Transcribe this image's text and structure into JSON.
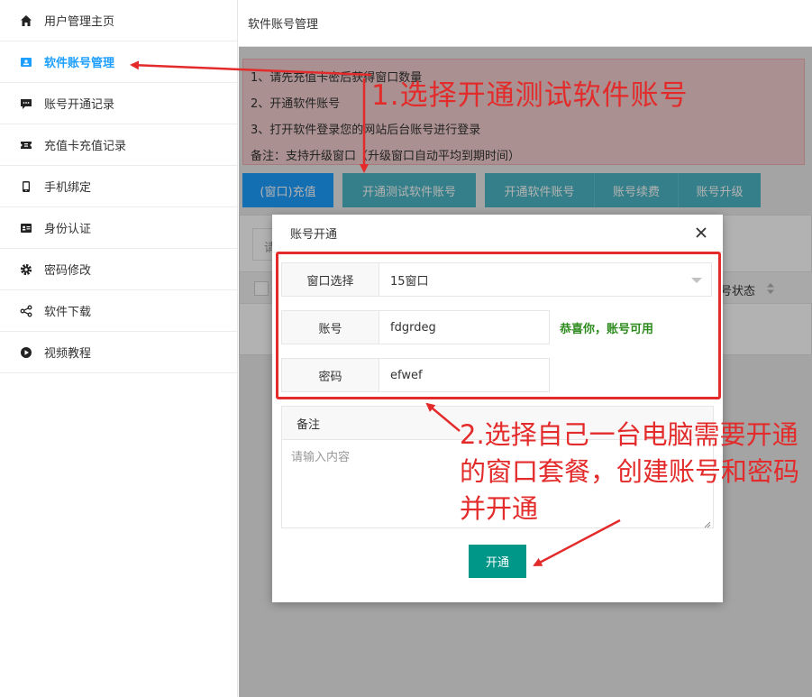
{
  "sidebar": {
    "items": [
      {
        "label": "用户管理主页",
        "icon": "home-icon"
      },
      {
        "label": "软件账号管理",
        "icon": "id-card-icon",
        "active": true
      },
      {
        "label": "账号开通记录",
        "icon": "chat-icon"
      },
      {
        "label": "充值卡充值记录",
        "icon": "ticket-icon"
      },
      {
        "label": "手机绑定",
        "icon": "phone-icon"
      },
      {
        "label": "身份认证",
        "icon": "vcard-icon"
      },
      {
        "label": "密码修改",
        "icon": "gear-icon"
      },
      {
        "label": "软件下载",
        "icon": "share-icon"
      },
      {
        "label": "视频教程",
        "icon": "play-icon"
      }
    ],
    "active_color": "#1e9fff"
  },
  "header": {
    "title": "软件账号管理"
  },
  "notice": {
    "lines": [
      "1、请先充值卡密后获得窗口数量",
      "2、开通软件账号",
      "3、打开软件登录您的网站后台账号进行登录",
      "备注：支持升级窗口（升级窗口自动平均到期时间）"
    ]
  },
  "toolbar": {
    "buttons": [
      {
        "label": "(窗口)充值",
        "color": "#1e9fff"
      },
      {
        "label": "开通测试软件账号",
        "color": "#4bb7c5"
      },
      {
        "label": "开通软件账号",
        "color": "#4bb7c5"
      },
      {
        "label": "账号续费",
        "color": "#4bb7c5"
      },
      {
        "label": "账号升级",
        "color": "#4bb7c5"
      }
    ]
  },
  "table": {
    "search_placeholder_fragment": "请",
    "status_header_fragment": "号状态"
  },
  "modal": {
    "title": "账号开通",
    "window_label": "窗口选择",
    "window_value": "15窗口",
    "account_label": "账号",
    "account_value": "fdgrdeg",
    "account_status": "恭喜你，账号可用",
    "password_label": "密码",
    "password_value": "efwef",
    "remark_label": "备注",
    "remark_placeholder": "请输入内容",
    "submit_label": "开通"
  },
  "annotations": {
    "step1": "1.选择开通测试软件账号",
    "step2": "2.选择自己一台电脑需要开通的窗口套餐，创建账号和密码并开通",
    "color": "#e32b2b"
  }
}
